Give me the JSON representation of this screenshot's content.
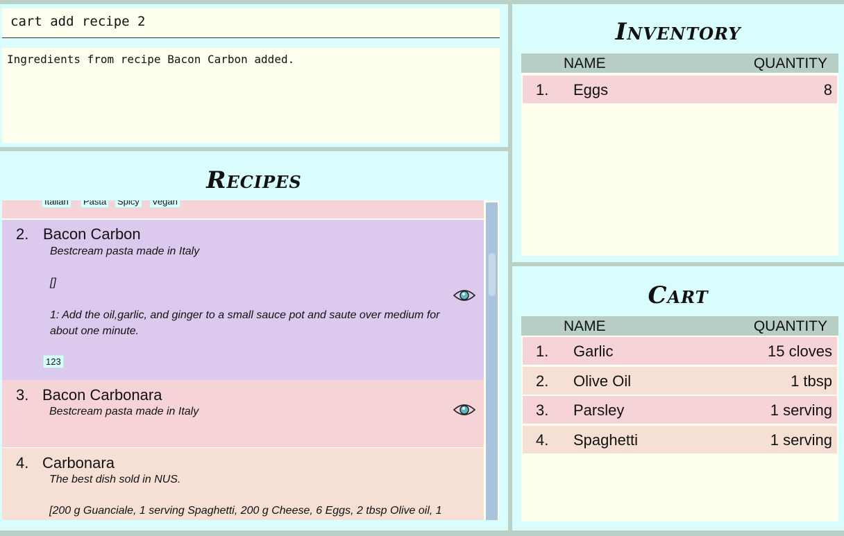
{
  "command": {
    "input_value": "cart add recipe 2"
  },
  "result": {
    "message": "Ingredients from recipe Bacon Carbon added."
  },
  "recipes": {
    "title": "Recipes",
    "top_partial_tags": [
      "Italian",
      "Pasta",
      "Spicy",
      "Vegan"
    ],
    "items": [
      {
        "index": "2.",
        "name": "Bacon Carbon",
        "description": "Bestcream pasta made in Italy",
        "ingredients": "[]",
        "steps": "1: Add the oil,garlic, and ginger to a small sauce pot and saute over medium for about one minute.",
        "tags": [
          "123"
        ],
        "color": "#dccaee"
      },
      {
        "index": "3.",
        "name": "Bacon Carbonara",
        "description": "Bestcream pasta made in Italy",
        "color": "#f5d3d6"
      },
      {
        "index": "4.",
        "name": "Carbonara",
        "description": "The best dish sold in NUS.",
        "ingredients": "[200 g Guanciale, 1 serving Spaghetti, 200 g Cheese, 6 Eggs, 2 tbsp Olive oil, 1",
        "color": "#f6e0d6"
      }
    ]
  },
  "inventory": {
    "title": "Inventory",
    "headers": {
      "name": "NAME",
      "quantity": "QUANTITY"
    },
    "rows": [
      {
        "index": "1.",
        "name": "Eggs",
        "quantity": "8"
      }
    ]
  },
  "cart": {
    "title": "Cart",
    "headers": {
      "name": "NAME",
      "quantity": "QUANTITY"
    },
    "rows": [
      {
        "index": "1.",
        "name": "Garlic",
        "quantity": "15 cloves"
      },
      {
        "index": "2.",
        "name": "Olive Oil",
        "quantity": "1 tbsp"
      },
      {
        "index": "3.",
        "name": "Parsley",
        "quantity": "1 serving"
      },
      {
        "index": "4.",
        "name": "Spaghetti",
        "quantity": "1 serving"
      }
    ]
  },
  "colors": {
    "accent_bg": "#d9fcfc",
    "cream": "#fffff0",
    "border": "#b9d1c6",
    "row_pink": "#f5d3d6",
    "row_peach": "#f6e0d6",
    "row_purple": "#dccaee",
    "scrollbar": "#a9c3dc"
  },
  "icons": {
    "view": "eye-icon"
  }
}
